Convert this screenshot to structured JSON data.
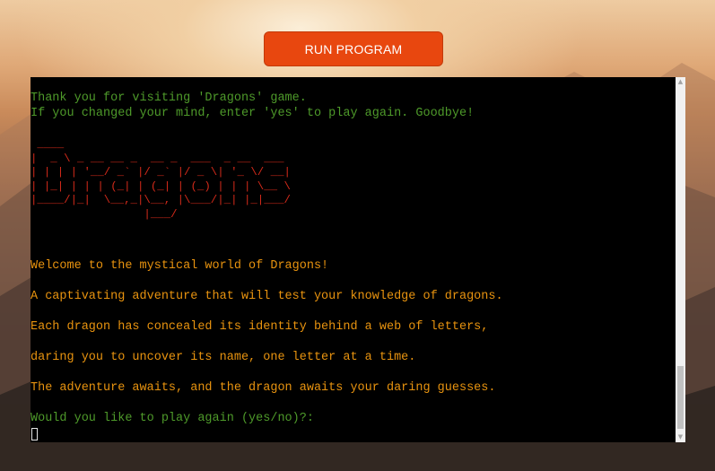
{
  "toolbar": {
    "run_label": "RUN PROGRAM"
  },
  "terminal": {
    "line1": "Thank you for visiting 'Dragons' game.",
    "line2": "If you changed your mind, enter 'yes' to play again. Goodbye!",
    "ascii_art": " ____\n|  _ \\ _ __ __ _  __ _  ___  _ __  ___\n| | | | '__/ _` |/ _` |/ _ \\| '_ \\/ __|\n| |_| | | | (_| | (_| | (_) | | | \\__ \\\n|____/|_|  \\__,_|\\__, |\\___/|_| |_|___/\n                 |___/",
    "welcome": "Welcome to the mystical world of Dragons!",
    "intro1": "A captivating adventure that will test your knowledge of dragons.",
    "intro2": "Each dragon has concealed its identity behind a web of letters,",
    "intro3": "daring you to uncover its name, one letter at a time.",
    "intro4": "The adventure awaits, and the dragon awaits your daring guesses.",
    "prompt": "Would you like to play again (yes/no)?:"
  },
  "colors": {
    "button": "#e8470f",
    "text_green": "#4e9a2a",
    "text_orange": "#e8930f",
    "text_red": "#d42a1a"
  },
  "icons": {
    "scroll_up": "triangle-up-icon",
    "scroll_down": "triangle-down-icon"
  }
}
